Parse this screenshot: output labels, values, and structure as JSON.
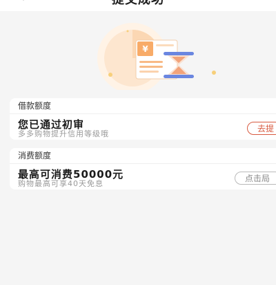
{
  "header": {
    "title": "提交成功"
  },
  "loan_card": {
    "section_label": "借款额度",
    "title": "您已通过初审",
    "subtitle": "多多购物提升信用等级哦",
    "button_label": "去提"
  },
  "consumption_card": {
    "section_label": "消费额度",
    "title": "最高可消费50000元",
    "subtitle": "购物最高可享40天免息",
    "button_label": "点击局"
  },
  "icons": {
    "back": "back-chevron-icon",
    "illustration": "hourglass-document-illustration",
    "currency_symbol": "¥"
  },
  "colors": {
    "accent": "#d8593f",
    "illustration_orange": "#f6b27a",
    "hourglass_blue": "#6a86e0"
  }
}
